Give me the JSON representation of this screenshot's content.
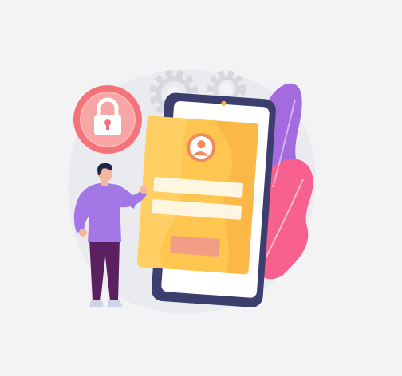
{
  "illustration": {
    "subject": "login-security",
    "icons": [
      "lock-icon",
      "user-avatar-icon",
      "gear-icon"
    ],
    "form": {
      "field_count": 2,
      "button_count": 1
    },
    "colors": {
      "background": "#f3f3f5",
      "blob": "#e9ebef",
      "gear": "#d6d8de",
      "phone_frame": "#3c3f6e",
      "phone_screen": "#ffffff",
      "card": "#ffc64f",
      "card_dark": "#f7a73c",
      "avatar_ring": "#f08a5d",
      "lock_badge": "#f3737a",
      "lock_badge_light": "#f8b6b3",
      "leaf_pink": "#f7608f",
      "leaf_purple": "#a46be0",
      "shirt": "#a377e6",
      "pants": "#5a2060",
      "skin": "#f6b79f",
      "hair": "#1f2448",
      "form_field": "#fff6e2",
      "form_button": "#f29d85"
    }
  }
}
